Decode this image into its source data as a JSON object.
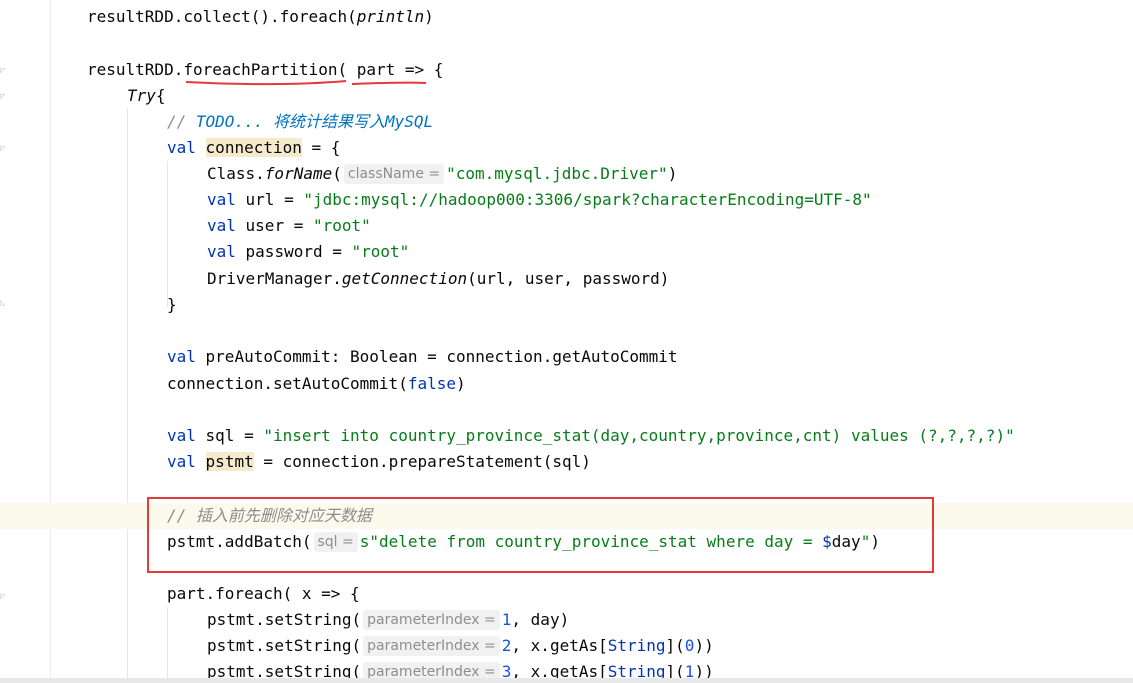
{
  "editor": {
    "lines": {
      "l1": {
        "a": "resultRDD.collect().foreach(",
        "b": "println",
        "c": ")"
      },
      "l2": {
        "a": "resultRDD.",
        "b": "foreachPartition",
        "c": "( part => {"
      },
      "l3": {
        "a": "Try",
        "b": "{"
      },
      "l4": {
        "a": "// ",
        "b": "TODO... 将统计结果写入MySQL"
      },
      "l5": {
        "kw": "val",
        "name": "connection",
        "rest": " = {"
      },
      "l6": {
        "a": "Class.",
        "b": "forName",
        "c": "(",
        "hint": "className =",
        "str": "\"com.mysql.jdbc.Driver\"",
        "d": ")"
      },
      "l7": {
        "kw": "val",
        "rest": " url = ",
        "str": "\"jdbc:mysql://hadoop000:3306/spark?characterEncoding=UTF-8\""
      },
      "l8": {
        "kw": "val",
        "rest": " user = ",
        "str": "\"root\""
      },
      "l9": {
        "kw": "val",
        "rest": " password = ",
        "str": "\"root\""
      },
      "l10": {
        "a": "DriverManager.",
        "b": "getConnection",
        "c": "(url, user, password)"
      },
      "l11": {
        "a": "}"
      },
      "l12": {
        "kw": "val",
        "rest": " preAutoCommit: Boolean = connection.getAutoCommit"
      },
      "l13": {
        "a": "connection.setAutoCommit(",
        "kw": "false",
        "c": ")"
      },
      "l14": {
        "kw": "val",
        "rest": " sql = ",
        "str": "\"insert into country_province_stat(day,country,province,cnt) values (?,?,?,?)\""
      },
      "l15": {
        "kw": "val",
        "name": "pstmt",
        "rest": " = connection.prepareStatement(sql)"
      },
      "l16": {
        "a": "// 插入前先删除对应天数据"
      },
      "l17": {
        "a": "pstmt.addBatch(",
        "hint": "sql =",
        "s1": "s\"delete from country_province_stat where day = ",
        "dollar": "$",
        "v": "day",
        "s2": "\"",
        "c": ")"
      },
      "l18": {
        "a": "part.foreach( x => {"
      },
      "l19": {
        "a": "pstmt.setString(",
        "hint": "parameterIndex =",
        "num": "1",
        "c": ", day)"
      },
      "l20": {
        "a": "pstmt.setString(",
        "hint": "parameterIndex =",
        "num": "2",
        "c": ", x.getAs[",
        "type": "String",
        "d": "](",
        "num2": "0",
        "e": "))"
      },
      "l21": {
        "a": "pstmt.setString(",
        "hint": "parameterIndex =",
        "num": "3",
        "c": ", x.getAs[",
        "type": "String",
        "d": "](",
        "num2": "1",
        "e": "))"
      }
    }
  },
  "colors": {
    "keyword": "#0033b3",
    "string": "#067d17",
    "comment": "#8c8c8c",
    "annotation_box": "#e53a3a",
    "underline": "#e53a3a"
  }
}
